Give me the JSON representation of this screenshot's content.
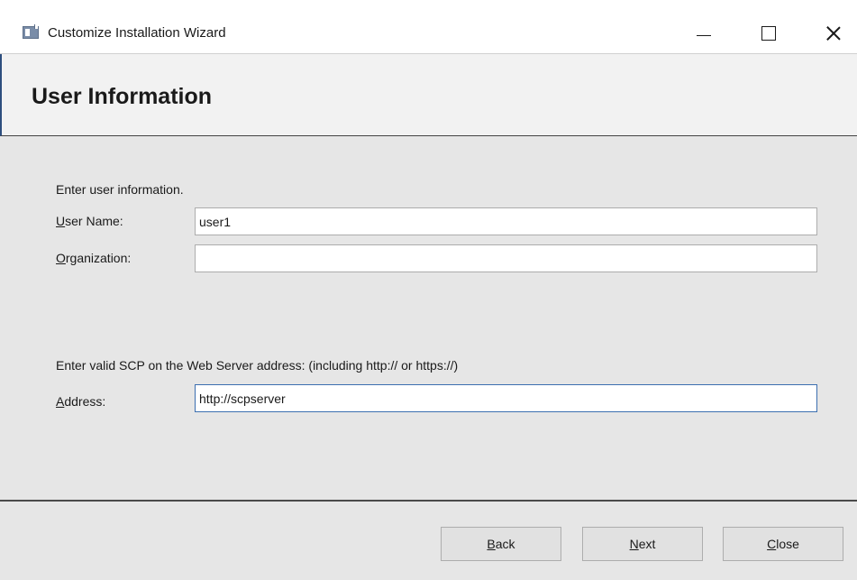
{
  "window": {
    "title": "Customize Installation Wizard",
    "icon": "app-window-icon",
    "controls": [
      "minimize-icon",
      "maximize-icon",
      "close-icon"
    ]
  },
  "header": {
    "title": "User Information"
  },
  "user_section": {
    "prompt": "Enter user information.",
    "user_name": {
      "label_mnemonic": "U",
      "label_rest": "ser Name:",
      "value": "user1"
    },
    "organization": {
      "label_mnemonic": "O",
      "label_rest": "rganization:",
      "value": ""
    }
  },
  "server_section": {
    "prompt": "Enter valid SCP on the Web Server address: (including http:// or https://)",
    "address": {
      "label_mnemonic": "A",
      "label_rest": "ddress:",
      "value": "http://scpserver"
    }
  },
  "footer": {
    "back": {
      "mnemonic": "B",
      "rest": "ack"
    },
    "next": {
      "mnemonic": "N",
      "rest": "ext"
    },
    "close": {
      "mnemonic": "C",
      "rest": "lose"
    }
  },
  "colors": {
    "accent": "#2d4e7e",
    "focus_border": "#3c6fb0",
    "background": "#e6e6e6"
  }
}
